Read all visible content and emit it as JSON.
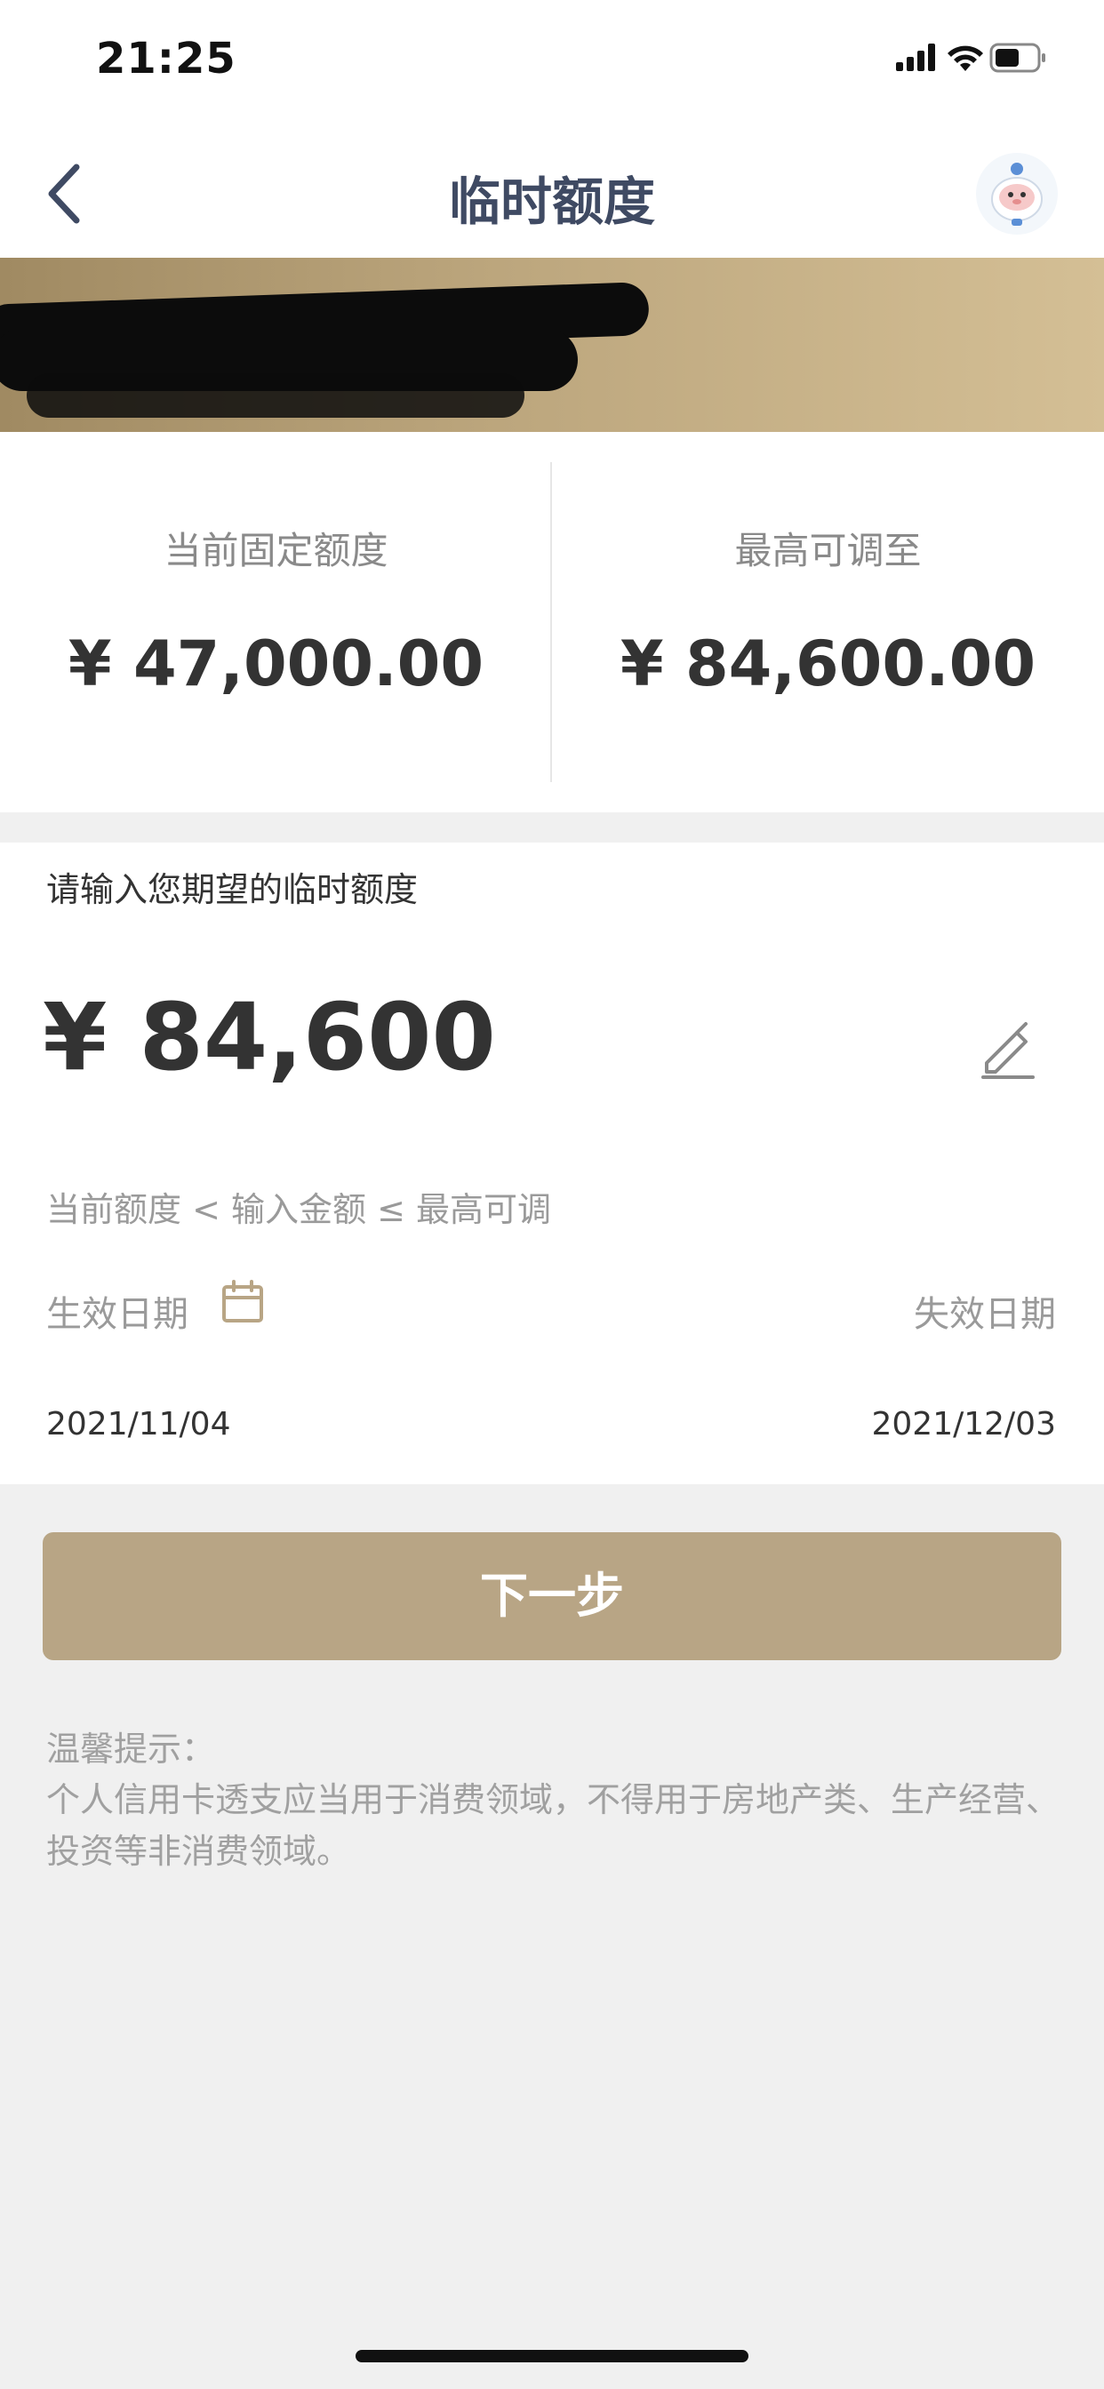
{
  "status_bar": {
    "time": "21:25",
    "icons": [
      "signal-icon",
      "wifi-icon",
      "battery-icon"
    ]
  },
  "nav": {
    "title": "临时额度",
    "back_icon": "chevron-left-icon",
    "avatar_icon": "assistant-avatar-icon"
  },
  "limits": {
    "current": {
      "label": "当前固定额度",
      "value": "¥ 47,000.00"
    },
    "max": {
      "label": "最高可调至",
      "value": "¥ 84,600.00"
    }
  },
  "form": {
    "prompt": "请输入您期望的临时额度",
    "amount": "¥ 84,600",
    "edit_icon": "pencil-icon",
    "range_hint": "当前额度 < 输入金额 ≤ 最高可调",
    "start_label": "生效日期",
    "calendar_icon": "calendar-icon",
    "end_label": "失效日期",
    "start_date": "2021/11/04",
    "end_date": "2021/12/03"
  },
  "next_button": {
    "label": "下一步"
  },
  "tips": {
    "title": "温馨提示：",
    "body": "个人信用卡透支应当用于消费领域，不得用于房地产类、生产经营、投资等非消费领域。"
  },
  "colors": {
    "accent": "#b8a585",
    "title": "#3f4a63",
    "banner_start": "#a08a62",
    "banner_end": "#d4bf95",
    "background": "#f0f0f0"
  }
}
